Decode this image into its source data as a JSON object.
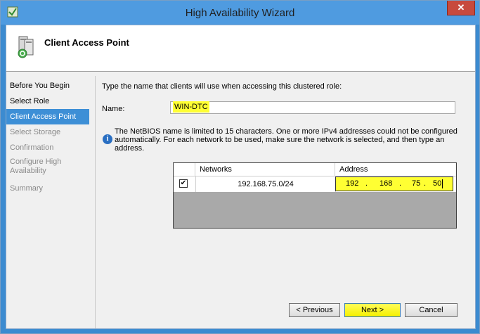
{
  "window": {
    "title": "High Availability Wizard",
    "close_glyph": "✕",
    "accent_color": "#4f9be0"
  },
  "header": {
    "title": "Client Access Point",
    "icon": "cluster-server-icon"
  },
  "steps": [
    {
      "label": "Before You Begin",
      "state": "done"
    },
    {
      "label": "Select Role",
      "state": "done"
    },
    {
      "label": "Client Access Point",
      "state": "active"
    },
    {
      "label": "Select Storage",
      "state": "disabled"
    },
    {
      "label": "Confirmation",
      "state": "disabled"
    },
    {
      "label": "Configure High Availability",
      "state": "disabled"
    },
    {
      "label": "Summary",
      "state": "disabled"
    }
  ],
  "main": {
    "instruction": "Type the name that clients will use when accessing this clustered role:",
    "name_label": "Name:",
    "name_value": "WIN-DTC",
    "info_text": "The NetBIOS name is limited to 15 characters.  One or more IPv4 addresses could not be configured automatically.  For each network to be used, make sure the network is selected, and then type an address.",
    "info_icon": "info-icon"
  },
  "grid": {
    "headers": [
      "",
      "Networks",
      "Address"
    ],
    "rows": [
      {
        "checked": true,
        "check_glyph": "✔",
        "network": "192.168.75.0/24",
        "address": [
          "192",
          "168",
          "75",
          "50"
        ]
      }
    ],
    "dot": "."
  },
  "buttons": {
    "previous": "< Previous",
    "next": "Next >",
    "cancel": "Cancel"
  },
  "highlight_color": "#ffff33"
}
